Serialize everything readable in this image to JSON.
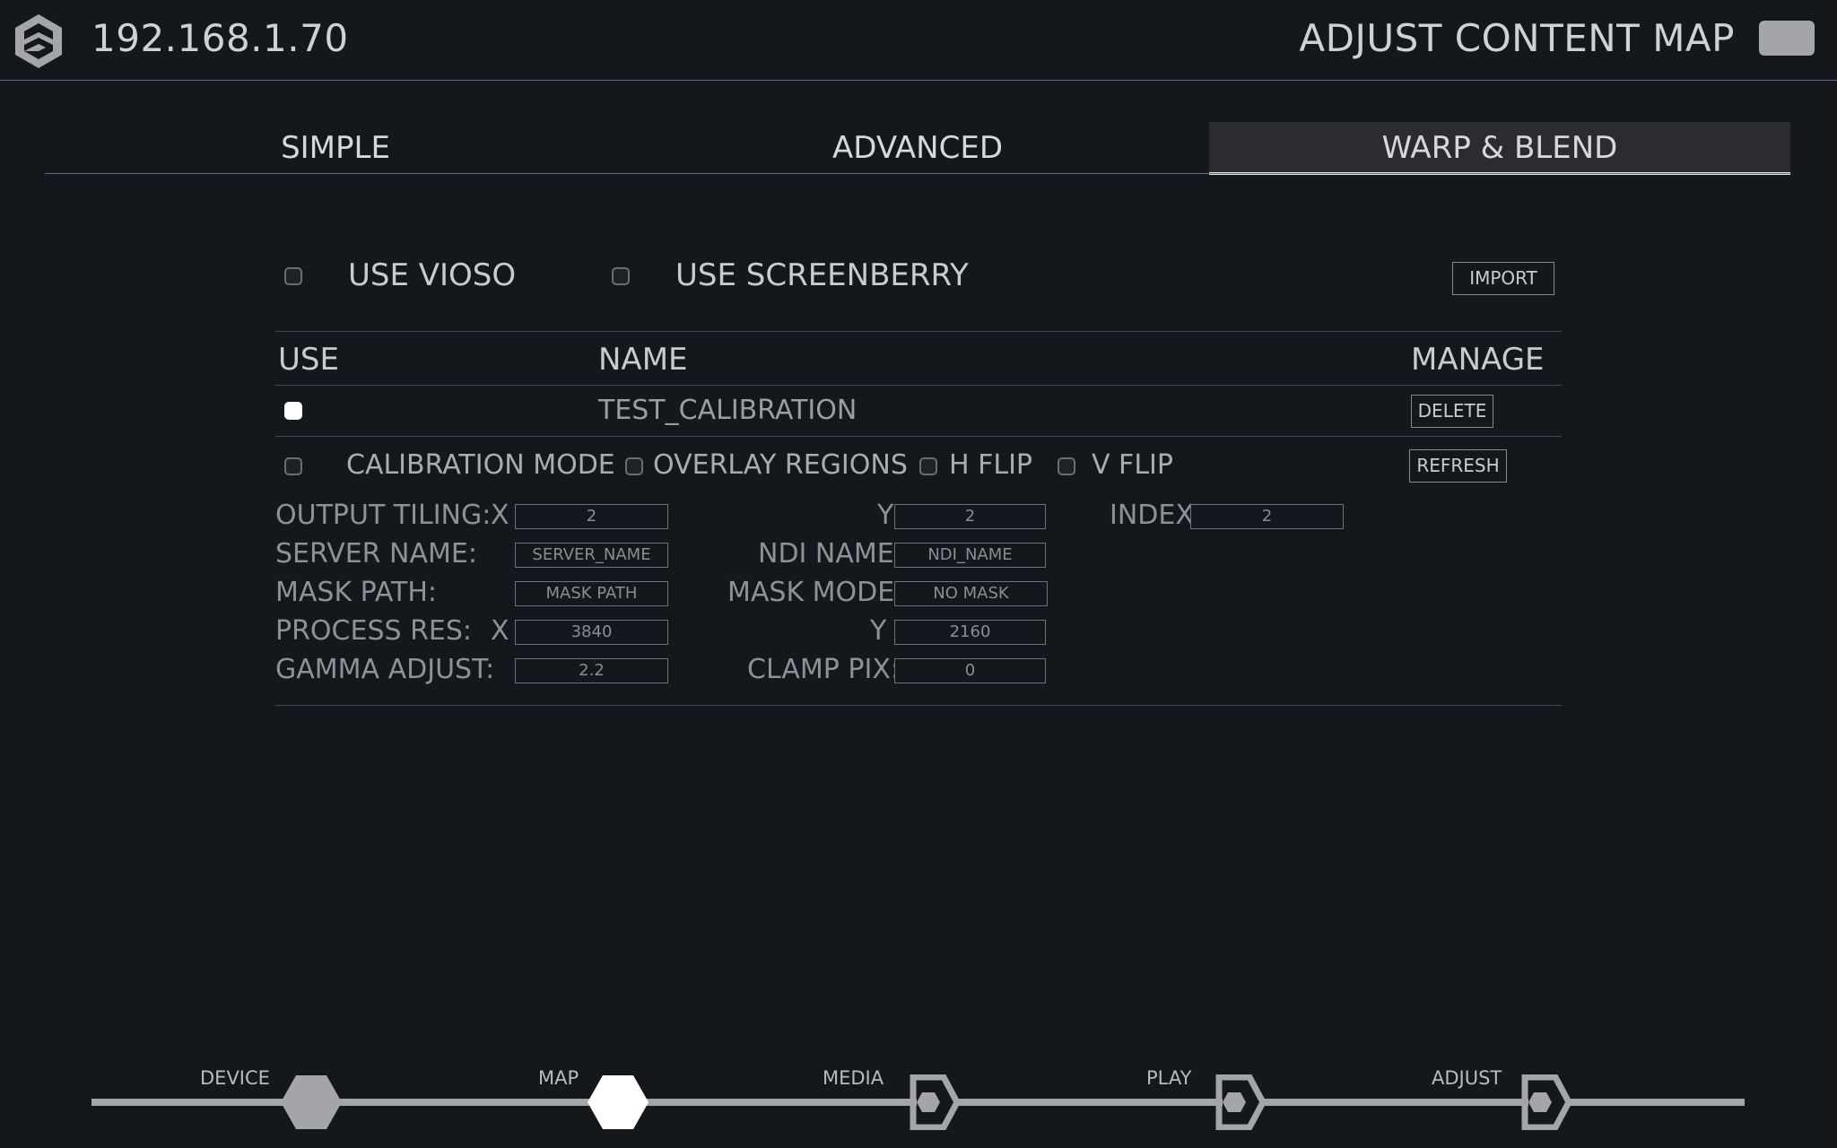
{
  "header": {
    "ip": "192.168.1.70",
    "title": "ADJUST CONTENT MAP",
    "logo_icon": "shield-logo-icon",
    "menu_icon": "menu-icon"
  },
  "tabs": [
    {
      "label": "SIMPLE",
      "active": false
    },
    {
      "label": "ADVANCED",
      "active": false
    },
    {
      "label": "WARP & BLEND",
      "active": true
    }
  ],
  "options": {
    "use_vioso": {
      "label": "USE VIOSO",
      "checked": false
    },
    "use_screenberry": {
      "label": "USE SCREENBERRY",
      "checked": false
    },
    "import_label": "IMPORT"
  },
  "table": {
    "headers": {
      "use": "USE",
      "name": "NAME",
      "manage": "MANAGE"
    },
    "rows": [
      {
        "use": true,
        "name": "TEST_CALIBRATION",
        "action": "DELETE"
      }
    ]
  },
  "toggles": {
    "calibration_mode": {
      "label": "CALIBRATION MODE",
      "checked": false
    },
    "overlay_regions": {
      "label": "OVERLAY REGIONS",
      "checked": false
    },
    "h_flip": {
      "label": "H FLIP",
      "checked": false
    },
    "v_flip": {
      "label": "V FLIP",
      "checked": false
    },
    "refresh_label": "REFRESH"
  },
  "settings": {
    "output_tiling": {
      "label": "OUTPUT TILING:",
      "x_label": "X",
      "x": "2",
      "y_label": "Y",
      "y": "2"
    },
    "index": {
      "label": "INDEX:",
      "value": "2"
    },
    "server_name": {
      "label": "SERVER NAME:",
      "value": "SERVER_NAME"
    },
    "ndi_name": {
      "label": "NDI NAME:",
      "value": "NDI_NAME"
    },
    "mask_path": {
      "label": "MASK PATH:",
      "value": "MASK PATH"
    },
    "mask_mode": {
      "label": "MASK MODE:",
      "value": "NO MASK"
    },
    "process_res": {
      "label": "PROCESS RES:",
      "x_label": "X",
      "x": "3840",
      "y_label": "Y",
      "y": "2160"
    },
    "gamma_adjust": {
      "label": "GAMMA ADJUST:",
      "value": "2.2"
    },
    "clamp_pix": {
      "label": "CLAMP PIX:",
      "value": "0"
    }
  },
  "steps": [
    {
      "label": "DEVICE",
      "state": "done"
    },
    {
      "label": "MAP",
      "state": "current"
    },
    {
      "label": "MEDIA",
      "state": "todo"
    },
    {
      "label": "PLAY",
      "state": "todo"
    },
    {
      "label": "ADJUST",
      "state": "todo"
    }
  ],
  "colors": {
    "background": "#14171c",
    "accent": "#ffffff",
    "muted": "#a3a5a9"
  }
}
